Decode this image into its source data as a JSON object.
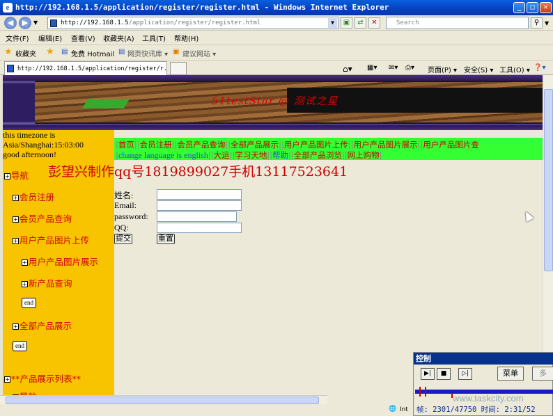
{
  "window": {
    "title": "http://192.168.1.5/application/register/register.html - Windows Internet Explorer",
    "ie_logo": "e"
  },
  "address": {
    "host": "http://192.168.1.5",
    "path": "/application/register/register.html"
  },
  "search": {
    "placeholder": "Search"
  },
  "menu": [
    "文件(F)",
    "编辑(E)",
    "查看(V)",
    "收藏夹(A)",
    "工具(T)",
    "帮助(H)"
  ],
  "favorites": {
    "label": "收藏夹",
    "items": [
      "免费 Hotmail",
      "网页快讯库 ▾",
      "建议网站 ▾"
    ]
  },
  "tab": {
    "title": "http://192.168.1.5/application/register/r...",
    "right_tools": [
      "页面(P) ▾",
      "安全(S) ▾",
      "工具(O) ▾"
    ]
  },
  "banner": {
    "text": "51testStar @  测试之星"
  },
  "sidebar": {
    "timezone_line1": "this timezone is",
    "timezone_line2": "Asia/Shanghai:15:03:00",
    "greeting": "good afternoon!",
    "items": [
      {
        "label": "导航"
      },
      {
        "label": "会员注册"
      },
      {
        "label": "会员产品查询"
      },
      {
        "label": "用户产品图片上传"
      },
      {
        "label": "用户产品图片展示"
      },
      {
        "label": "新产品查询"
      },
      {
        "label": "全部产品展示"
      },
      {
        "label": "**产品展示列表**"
      },
      {
        "label": "导航"
      }
    ],
    "end_label": "end"
  },
  "topnav": {
    "row1": [
      "首页",
      "会员注册",
      "会员产品查询",
      "全部产品展示",
      "用户产品图片上传",
      "用户产品图片展示",
      "用户产品图片查"
    ],
    "change_lang": "change language is english",
    "row2": [
      "大运",
      "学习天地",
      "帮助",
      "全部产品浏览",
      "网上购物"
    ]
  },
  "author_line": "彭望兴制作qq号1819899027手机13117523641",
  "form": {
    "name_label": "姓名:",
    "email_label": "Email:",
    "password_label": "password:",
    "qq_label": "QQ:",
    "submit_label": "提交",
    "reset_label": "重置"
  },
  "status": {
    "zone": "Int"
  },
  "control": {
    "title": "控制",
    "menu_label": "菜单",
    "more_label": "多",
    "watermark": "www.taskcity.com",
    "frames": "帧: 2301/47750 时间: 2:31/52"
  }
}
